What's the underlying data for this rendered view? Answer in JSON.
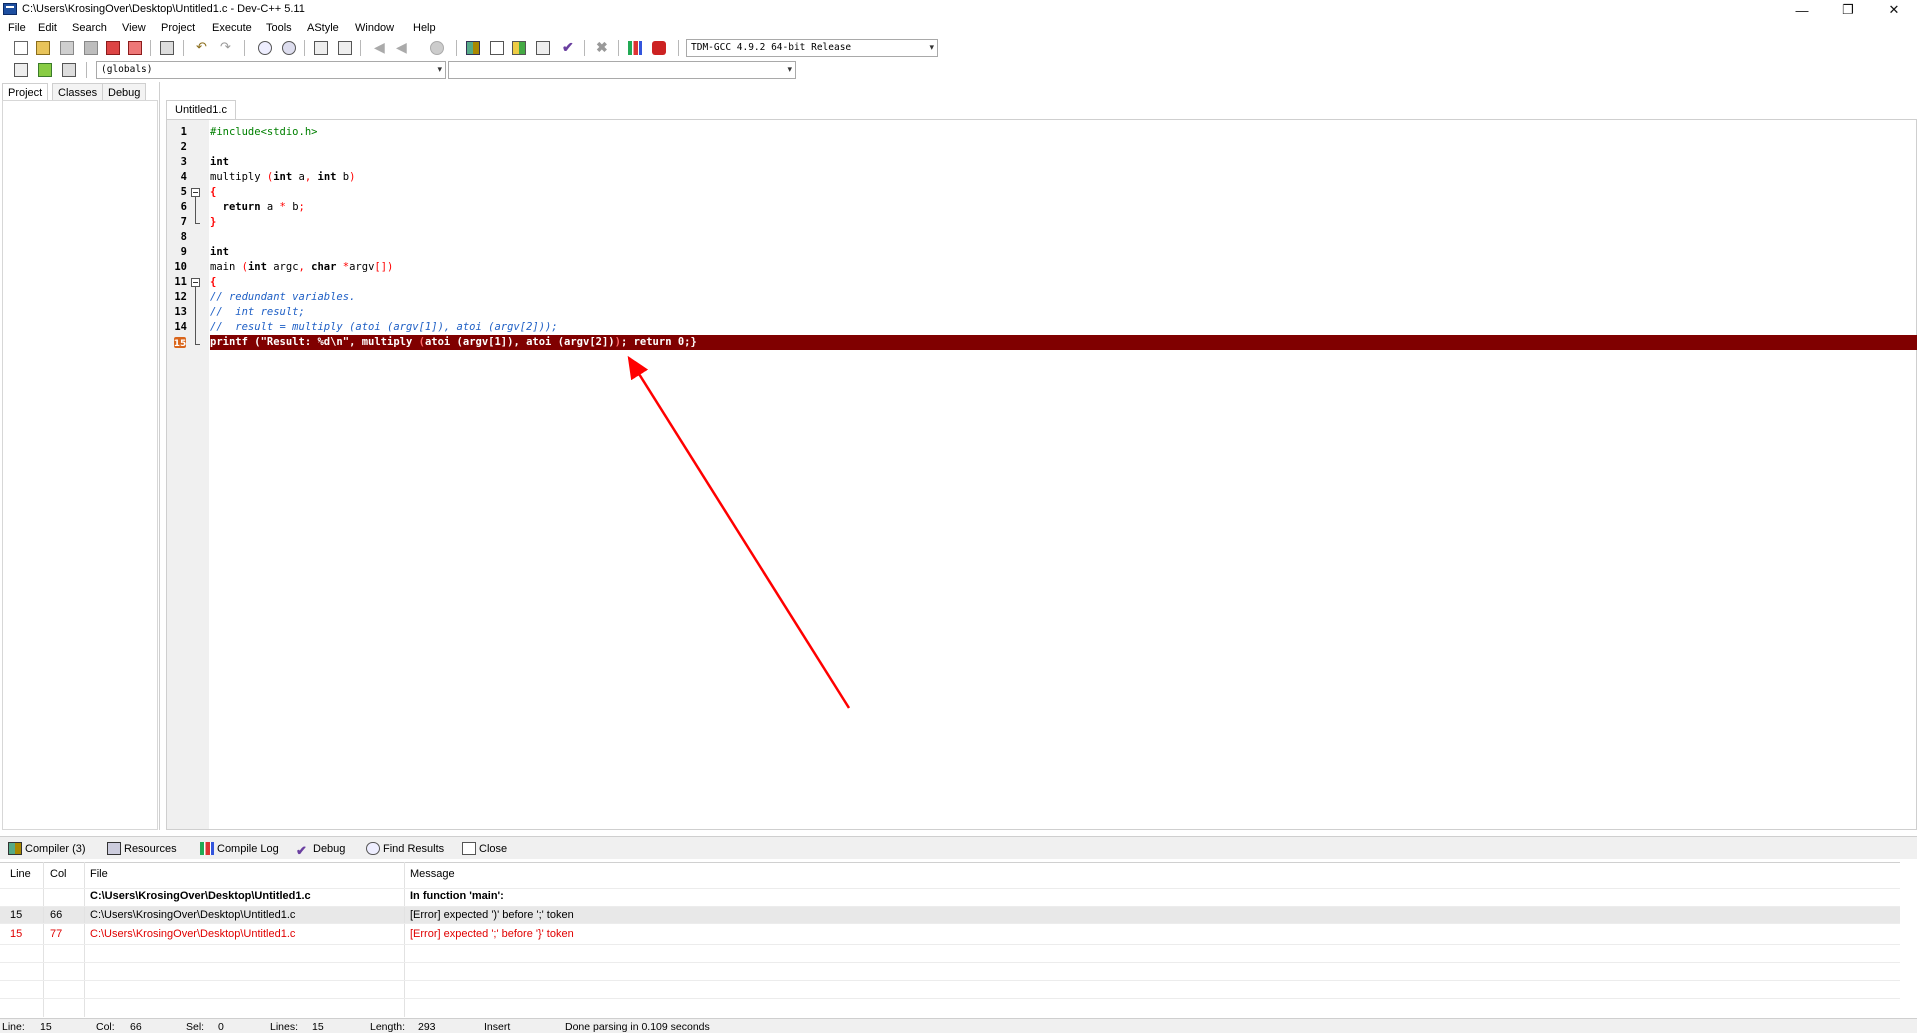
{
  "window": {
    "title": "C:\\Users\\KrosingOver\\Desktop\\Untitled1.c - Dev-C++ 5.11",
    "controls": [
      "—",
      "❐",
      "✕"
    ]
  },
  "menu": [
    "File",
    "Edit",
    "Search",
    "View",
    "Project",
    "Execute",
    "Tools",
    "AStyle",
    "Window",
    "Help"
  ],
  "toolbar": {
    "compiler_select": "TDM-GCC 4.9.2 64-bit Release",
    "scope_select": "(globals)",
    "member_select": ""
  },
  "left_panel": {
    "tabs": [
      "Project",
      "Classes",
      "Debug"
    ]
  },
  "editor": {
    "tab": "Untitled1.c",
    "line_numbers": [
      "1",
      "2",
      "3",
      "4",
      "5",
      "6",
      "7",
      "8",
      "9",
      "10",
      "11",
      "12",
      "13",
      "14",
      "15"
    ],
    "lines": {
      "l1": "#include<stdio.h>",
      "l3": "int",
      "l4_fn": "multiply ",
      "l4_p1": "(",
      "l4_k1": "int",
      "l4_a": " a",
      "l4_c": ",",
      "l4_k2": " int",
      "l4_b": " b",
      "l4_p2": ")",
      "l5": "{",
      "l6_kw": "  return",
      "l6_a": " a ",
      "l6_op": "*",
      "l6_b": " b",
      "l6_sc": ";",
      "l7": "}",
      "l9": "int",
      "l10_fn": "main ",
      "l10_p1": "(",
      "l10_k1": "int",
      "l10_a": " argc",
      "l10_c": ",",
      "l10_k2": " char",
      "l10_b": " ",
      "l10_star": "*",
      "l10_argv": "argv",
      "l10_br": "[])",
      "l11": "{",
      "l12": "// redundant variables.",
      "l13": "//  int result;",
      "l14": "//  result = multiply (atoi (argv[1]), atoi (argv[2]));",
      "l15_a": "printf (\"Result: %d\\n\", multiply ",
      "l15_b": "(",
      "l15_c": "atoi (argv[1]), atoi (argv[2])",
      "l15_d": ")",
      "l15_e": "; return 0;}"
    }
  },
  "bottom_panel": {
    "tabs": [
      "Compiler (3)",
      "Resources",
      "Compile Log",
      "Debug",
      "Find Results",
      "Close"
    ],
    "columns": [
      "Line",
      "Col",
      "File",
      "Message"
    ],
    "rows": [
      {
        "line": "",
        "col": "",
        "file": "C:\\Users\\KrosingOver\\Desktop\\Untitled1.c",
        "message": "In function 'main':"
      },
      {
        "line": "15",
        "col": "66",
        "file": "C:\\Users\\KrosingOver\\Desktop\\Untitled1.c",
        "message": "[Error] expected ')' before ';' token"
      },
      {
        "line": "15",
        "col": "77",
        "file": "C:\\Users\\KrosingOver\\Desktop\\Untitled1.c",
        "message": "[Error] expected ';' before '}' token"
      }
    ]
  },
  "status": {
    "line_label": "Line:",
    "line": "15",
    "col_label": "Col:",
    "col": "66",
    "sel_label": "Sel:",
    "sel": "0",
    "lines_label": "Lines:",
    "lines": "15",
    "length_label": "Length:",
    "length": "293",
    "mode": "Insert",
    "message": "Done parsing in 0.109 seconds"
  },
  "colors": {
    "error_line_bg": "#800000",
    "error_text": "#e00000",
    "annotation_arrow": "#ff0000",
    "comment": "#1e5fc5",
    "preprocessor": "#008000"
  }
}
